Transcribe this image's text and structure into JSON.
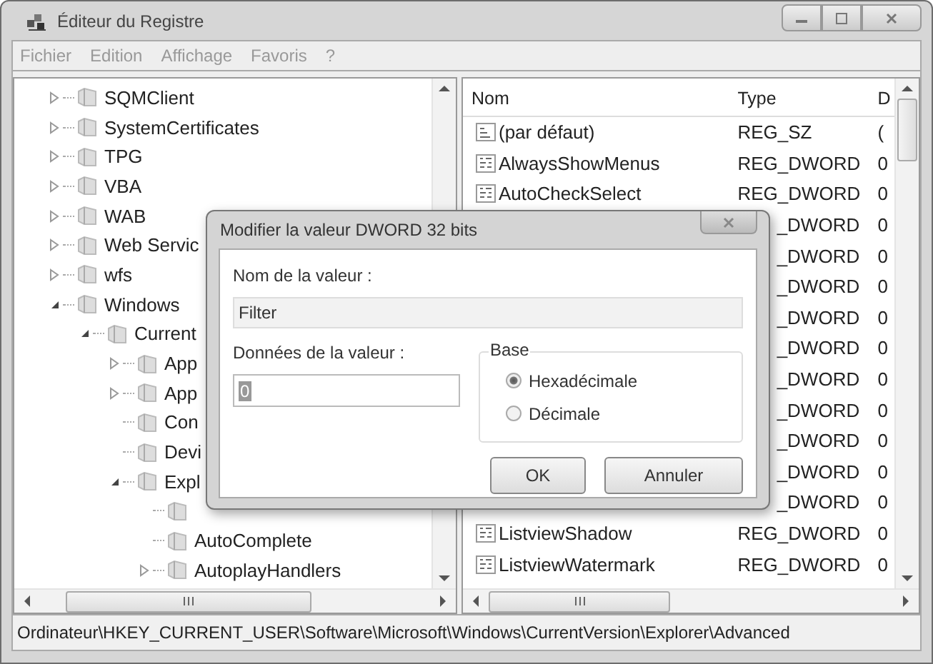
{
  "window": {
    "title": "Éditeur du Registre"
  },
  "menu": [
    "Fichier",
    "Edition",
    "Affichage",
    "Favoris",
    "?"
  ],
  "tree": [
    {
      "label": "SQMClient",
      "kind": "collapsed"
    },
    {
      "label": "SystemCertificates",
      "kind": "collapsed"
    },
    {
      "label": "TPG",
      "kind": "collapsed"
    },
    {
      "label": "VBA",
      "kind": "collapsed"
    },
    {
      "label": "WAB",
      "kind": "collapsed"
    },
    {
      "label": "Web Servic",
      "kind": "collapsed"
    },
    {
      "label": "wfs",
      "kind": "collapsed"
    },
    {
      "label": "Windows",
      "kind": "expanded",
      "children": [
        {
          "label": "Current",
          "kind": "expanded",
          "children": [
            {
              "label": "App",
              "kind": "collapsed"
            },
            {
              "label": "App",
              "kind": "collapsed"
            },
            {
              "label": "Con",
              "kind": "leaf"
            },
            {
              "label": "Devi",
              "kind": "leaf"
            },
            {
              "label": "Expl",
              "kind": "expanded",
              "children": [
                {
                  "kind": "leaf"
                },
                {
                  "label": "AutoComplete",
                  "kind": "leaf"
                },
                {
                  "label": "AutoplayHandlers",
                  "kind": "collapsed"
                }
              ]
            }
          ]
        }
      ]
    }
  ],
  "values": {
    "columns": [
      "Nom",
      "Type",
      "D"
    ],
    "rows": [
      {
        "kind": "string",
        "name": "(par défaut)",
        "type": "REG_SZ",
        "data": "("
      },
      {
        "kind": "dword",
        "name": "AlwaysShowMenus",
        "type": "REG_DWORD",
        "data": "0"
      },
      {
        "kind": "dword",
        "name": "AutoCheckSelect",
        "type": "REG_DWORD",
        "data": "0"
      },
      {
        "kind": "covered",
        "type": "_DWORD",
        "data": "0"
      },
      {
        "kind": "covered",
        "type": "_DWORD",
        "data": "0"
      },
      {
        "kind": "covered",
        "type": "_DWORD",
        "data": "0"
      },
      {
        "kind": "covered",
        "type": "_DWORD",
        "data": "0"
      },
      {
        "kind": "covered",
        "type": "_DWORD",
        "data": "0"
      },
      {
        "kind": "covered",
        "type": "_DWORD",
        "data": "0"
      },
      {
        "kind": "covered",
        "type": "_DWORD",
        "data": "0"
      },
      {
        "kind": "covered",
        "type": "_DWORD",
        "data": "0"
      },
      {
        "kind": "covered",
        "type": "_DWORD",
        "data": "0"
      },
      {
        "kind": "covered",
        "type": "_DWORD",
        "data": "0"
      },
      {
        "kind": "dword",
        "name": "ListviewShadow",
        "type": "REG_DWORD",
        "data": "0"
      },
      {
        "kind": "dword",
        "name": "ListviewWatermark",
        "type": "REG_DWORD",
        "data": "0"
      }
    ]
  },
  "status_bar": "Ordinateur\\HKEY_CURRENT_USER\\Software\\Microsoft\\Windows\\CurrentVersion\\Explorer\\Advanced",
  "dialog": {
    "title": "Modifier la valeur DWORD 32 bits",
    "name_label": "Nom de la valeur :",
    "name_value": "Filter",
    "data_label": "Données de la valeur :",
    "data_value": "0",
    "base": {
      "label": "Base",
      "options": [
        {
          "label": "Hexadécimale",
          "selected": true
        },
        {
          "label": "Décimale",
          "selected": false
        }
      ]
    },
    "buttons": [
      "OK",
      "Annuler"
    ]
  }
}
